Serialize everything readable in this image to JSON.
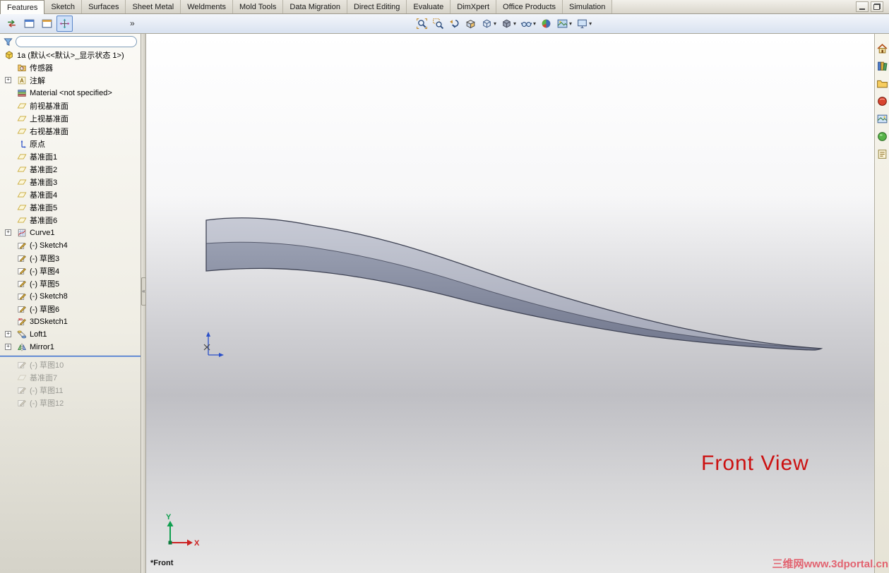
{
  "tabs": {
    "items": [
      "Features",
      "Sketch",
      "Surfaces",
      "Sheet Metal",
      "Weldments",
      "Mold Tools",
      "Data Migration",
      "Direct Editing",
      "Evaluate",
      "DimXpert",
      "Office Products",
      "Simulation"
    ],
    "active": "Features"
  },
  "window_controls": [
    "minimize",
    "restore"
  ],
  "toolbar": {
    "left_icons": [
      "swap-arrows-icon",
      "window-panel-icon",
      "window-panel-alt-icon",
      "four-arrows-icon"
    ],
    "view_tools": [
      "zoom-to-fit",
      "zoom-to-area",
      "previous-view",
      "section-view",
      "view-orientation",
      "display-style",
      "hide-show-items",
      "edit-appearance",
      "apply-scene",
      "view-settings"
    ]
  },
  "ui_glyphs": {
    "overflow_chevron": "»",
    "dropdown_caret": "▾",
    "expand_plus": "+",
    "splitter_grip": "«"
  },
  "feature_tree": {
    "filter_value": "",
    "root_label": "1a (默认<<默认>_显示状态 1>)",
    "items": [
      {
        "label": "传感器",
        "icon": "sensors-icon"
      },
      {
        "label": "注解",
        "icon": "annotations-icon",
        "expandable": true
      },
      {
        "label": "Material <not specified>",
        "icon": "material-icon"
      },
      {
        "label": "前视基准面",
        "icon": "plane-icon"
      },
      {
        "label": "上视基准面",
        "icon": "plane-icon"
      },
      {
        "label": "右视基准面",
        "icon": "plane-icon"
      },
      {
        "label": "原点",
        "icon": "origin-icon"
      },
      {
        "label": "基准面1",
        "icon": "plane-icon"
      },
      {
        "label": "基准面2",
        "icon": "plane-icon"
      },
      {
        "label": "基准面3",
        "icon": "plane-icon"
      },
      {
        "label": "基准面4",
        "icon": "plane-icon"
      },
      {
        "label": "基准面5",
        "icon": "plane-icon"
      },
      {
        "label": "基准面6",
        "icon": "plane-icon"
      },
      {
        "label": "Curve1",
        "icon": "curve-icon",
        "expandable": true
      },
      {
        "label": "(-) Sketch4",
        "icon": "sketch-icon"
      },
      {
        "label": "(-) 草图3",
        "icon": "sketch-icon"
      },
      {
        "label": "(-) 草图4",
        "icon": "sketch-icon"
      },
      {
        "label": "(-) 草图5",
        "icon": "sketch-icon"
      },
      {
        "label": "(-) Sketch8",
        "icon": "sketch-icon"
      },
      {
        "label": "(-) 草图6",
        "icon": "sketch-icon"
      },
      {
        "label": "3DSketch1",
        "icon": "sketch3d-icon"
      },
      {
        "label": "Loft1",
        "icon": "loft-icon",
        "expandable": true
      },
      {
        "label": "Mirror1",
        "icon": "mirror-icon",
        "expandable": true
      },
      {
        "label": "(-) 草图10",
        "icon": "sketch-icon",
        "suppressed": true
      },
      {
        "label": "基准面7",
        "icon": "plane-icon",
        "suppressed": true
      },
      {
        "label": "(-) 草图11",
        "icon": "sketch-icon",
        "suppressed": true
      },
      {
        "label": "(-) 草图12",
        "icon": "sketch-icon",
        "suppressed": true
      }
    ]
  },
  "task_pane": {
    "icons": [
      "solidworks-resources",
      "design-library",
      "file-explorer",
      "solidworks-search",
      "view-palette",
      "appearances-scenes",
      "custom-properties"
    ]
  },
  "viewport": {
    "view_label": "*Front",
    "annotation": "Front View",
    "axis_x": "X",
    "axis_y": "Y",
    "watermark": "三维网www.3dportal.cn"
  },
  "colors": {
    "annotation_red": "#cc1111",
    "watermark_pink": "#e24c5c",
    "rollback_blue": "#2f62c4",
    "model_gray": "#8d91a3"
  }
}
